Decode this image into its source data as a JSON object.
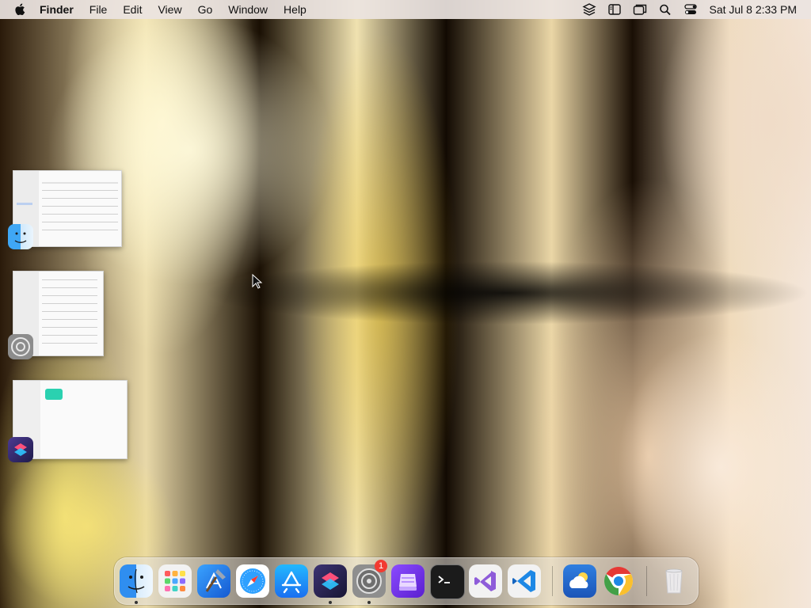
{
  "menubar": {
    "app_name": "Finder",
    "menus": [
      "File",
      "Edit",
      "View",
      "Go",
      "Window",
      "Help"
    ],
    "clock": "Sat Jul 8  2:33 PM",
    "status_icons": [
      "stack-icon",
      "sidebar-icon",
      "windows-icon",
      "search-icon",
      "control-center-icon"
    ]
  },
  "window_groups": [
    {
      "app": "finder-icon"
    },
    {
      "app": "system-settings-icon"
    },
    {
      "app": "shortcuts-icon"
    }
  ],
  "dock": {
    "items": [
      {
        "icon": "finder-icon",
        "running": true
      },
      {
        "icon": "launchpad-icon",
        "running": false
      },
      {
        "icon": "xcode-icon",
        "running": false
      },
      {
        "icon": "safari-icon",
        "running": false
      },
      {
        "icon": "app-store-icon",
        "running": false
      },
      {
        "icon": "shortcuts-icon",
        "running": true
      },
      {
        "icon": "system-settings-icon",
        "running": true,
        "badge": "1"
      },
      {
        "icon": "storage-app-icon",
        "running": false
      },
      {
        "icon": "terminal-icon",
        "running": false
      },
      {
        "icon": "visual-studio-icon",
        "running": false
      },
      {
        "icon": "vscode-icon",
        "running": false
      },
      {
        "icon": "weather-icon",
        "running": false
      },
      {
        "icon": "chrome-icon",
        "running": false
      },
      {
        "icon": "trash-icon",
        "running": false
      }
    ]
  },
  "colors": {
    "menubar_bg": "#ebe4e1",
    "badge": "#f23b31",
    "wallpaper_dark": "#1a1004",
    "wallpaper_light": "#f0e2b0"
  }
}
